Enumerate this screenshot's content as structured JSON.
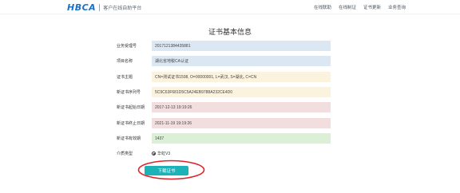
{
  "header": {
    "logo_text": "HBCA",
    "subtitle": "客户在线自助平台",
    "nav": [
      "在线联助",
      "在线制证",
      "证书更新",
      "业务查询"
    ]
  },
  "page_title": "证书基本信息",
  "fields": [
    {
      "label": "业务受理号",
      "value": "2017121384435881"
    },
    {
      "label": "项目名称",
      "value": "湖北省地税CA认证"
    },
    {
      "label": "证书主题",
      "value": "CN=测试证书1508, O=00000001, L=武汉, S=湖北, C=CN"
    },
    {
      "label": "新证书序列号",
      "value": "5C9C63F681D5C5A24EB9788A232CE4D0"
    },
    {
      "label": "新证书起始日期",
      "value": "2017-12-13 19:19:26"
    },
    {
      "label": "新证书终止日期",
      "value": "2021-11-19 19:19:26"
    },
    {
      "label": "新证书有效期",
      "value": "1437"
    }
  ],
  "media": {
    "label": "介质类型",
    "option": "华虹V3"
  },
  "download_button": "下载证书",
  "colors": {
    "brand": "#1a73c8",
    "button": "#1bb3b8",
    "highlight_ring": "#e0202a"
  }
}
